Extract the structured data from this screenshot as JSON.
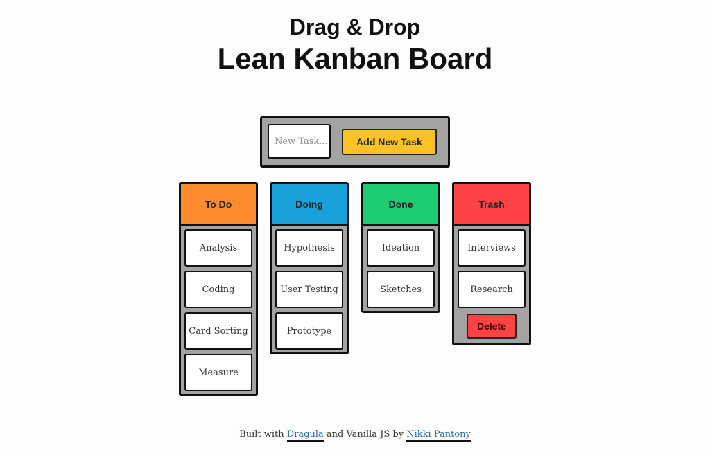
{
  "header": {
    "subtitle": "Drag & Drop",
    "title": "Lean Kanban Board"
  },
  "add_task": {
    "input_value": "",
    "input_placeholder": "New Task...",
    "button_label": "Add New Task",
    "button_color": "#fcc324"
  },
  "columns": [
    {
      "id": "todo",
      "title": "To Do",
      "color": "#fb8a2d",
      "cards": [
        "Analysis",
        "Coding",
        "Card Sorting",
        "Measure"
      ]
    },
    {
      "id": "doing",
      "title": "Doing",
      "color": "#17a0d9",
      "cards": [
        "Hypothesis",
        "User Testing",
        "Prototype"
      ]
    },
    {
      "id": "done",
      "title": "Done",
      "color": "#1bcc72",
      "cards": [
        "Ideation",
        "Sketches"
      ]
    },
    {
      "id": "trash",
      "title": "Trash",
      "color": "#fe4346",
      "cards": [
        "Interviews",
        "Research"
      ],
      "delete_label": "Delete",
      "delete_color": "#fe4346"
    }
  ],
  "footer": {
    "prefix": "Built with ",
    "link1": "Dragula",
    "middle": " and Vanilla JS by ",
    "link2": "Nikki Pantony"
  }
}
